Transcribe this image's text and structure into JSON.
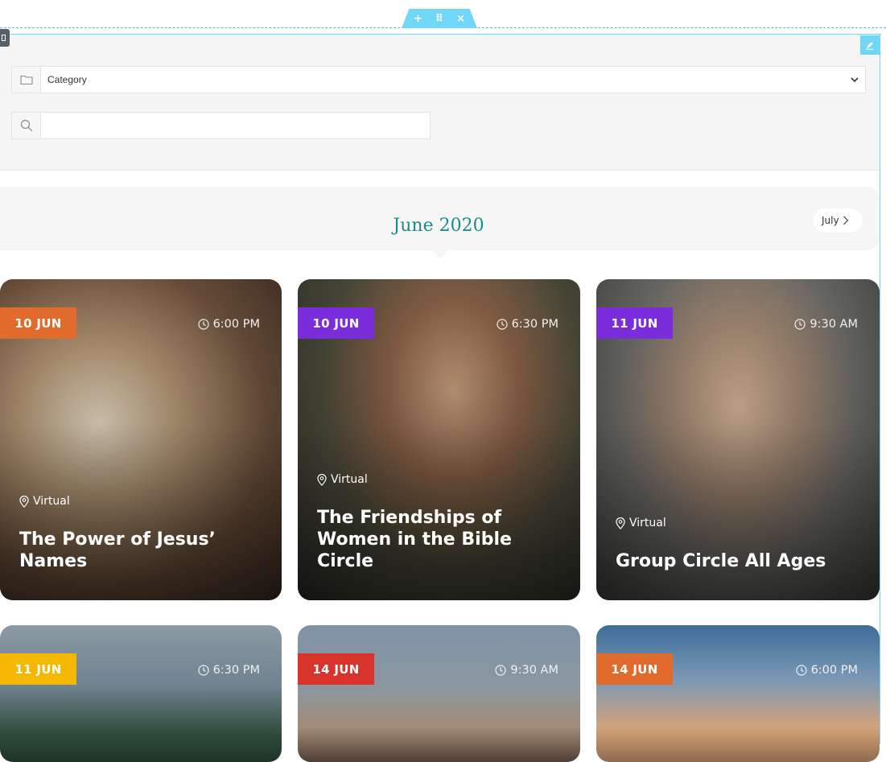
{
  "editor": {
    "add_symbol": "+",
    "move_symbol": "⠿",
    "close_symbol": "×"
  },
  "filters": {
    "category_selected": "Category",
    "search_value": ""
  },
  "calendar": {
    "month_title": "June 2020",
    "next_label": "July"
  },
  "events": [
    {
      "date": "10 JUN",
      "time": "6:00 PM",
      "location": "Virtual",
      "title": "The Power of Jesus’ Names",
      "badge_color": "#e06b2c"
    },
    {
      "date": "10 JUN",
      "time": "6:30 PM",
      "location": "Virtual",
      "title": "The Friendships of Women in the Bible Circle",
      "badge_color": "#7b2ddb"
    },
    {
      "date": "11 JUN",
      "time": "9:30 AM",
      "location": "Virtual",
      "title": "Group Circle All Ages",
      "badge_color": "#7b2ddb"
    },
    {
      "date": "11 JUN",
      "time": "6:30 PM",
      "location": "",
      "title": "",
      "badge_color": "#f5b800"
    },
    {
      "date": "14 JUN",
      "time": "9:30 AM",
      "location": "",
      "title": "",
      "badge_color": "#d9342b"
    },
    {
      "date": "14 JUN",
      "time": "6:00 PM",
      "location": "",
      "title": "",
      "badge_color": "#e06b2c"
    }
  ]
}
